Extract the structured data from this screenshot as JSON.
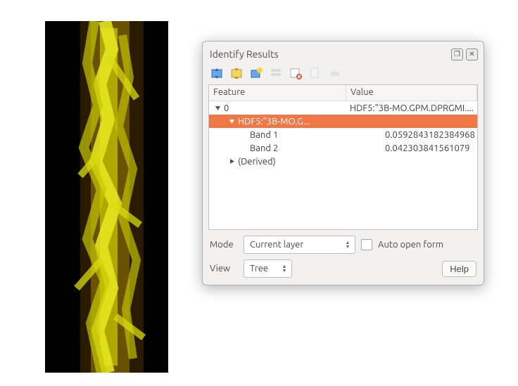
{
  "dialog": {
    "title": "Identify Results",
    "headers": {
      "feature": "Feature",
      "value": "Value"
    },
    "rows": {
      "root": {
        "label": "0",
        "value": "HDF5:\"3B-MO.GPM.DPRGMI...."
      },
      "layer": {
        "label": "HDF5:\"3B-MO.G...",
        "value": ""
      },
      "band1": {
        "label": "Band 1",
        "value": "0.0592843182384968"
      },
      "band2": {
        "label": "Band 2",
        "value": "0.042303841561079"
      },
      "derived": {
        "label": "(Derived)",
        "value": ""
      }
    },
    "mode": {
      "label": "Mode",
      "value": "Current layer"
    },
    "autoopen": {
      "label": "Auto open form"
    },
    "view": {
      "label": "View",
      "value": "Tree"
    },
    "help": "Help"
  }
}
